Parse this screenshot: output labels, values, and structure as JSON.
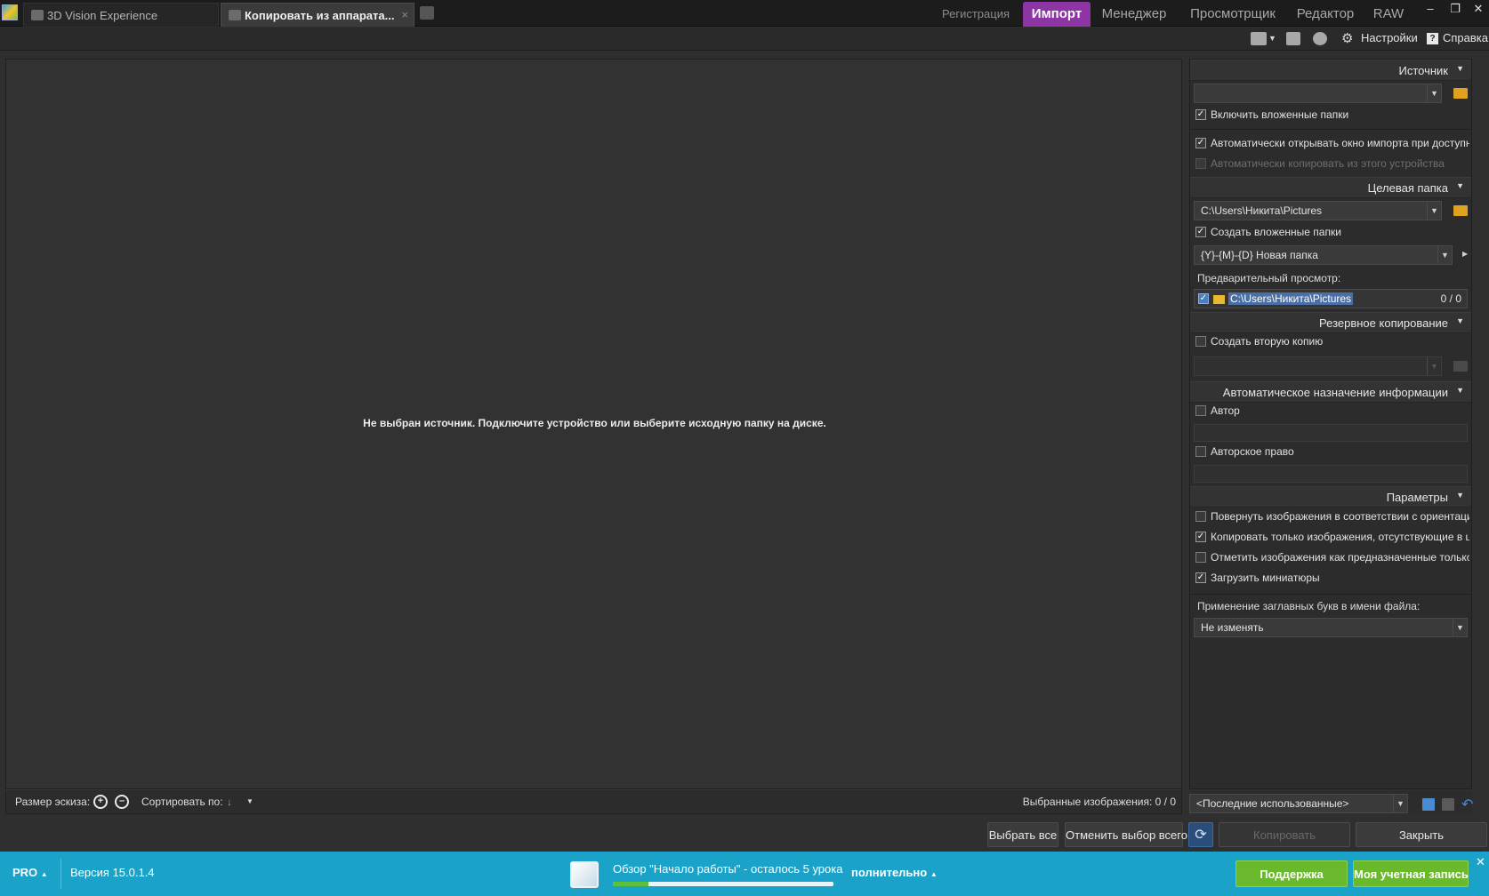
{
  "tabs": [
    {
      "label": "3D Vision Experience",
      "active": false
    },
    {
      "label": "Копировать из аппарата...",
      "active": true,
      "close": "×"
    }
  ],
  "modes": {
    "register": "Регистрация",
    "import": "Импорт",
    "manager": "Менеджер",
    "viewer": "Просмотрщик",
    "editor": "Редактор",
    "raw": "RAW"
  },
  "window_buttons": {
    "minimize": "–",
    "restore": "❐",
    "close": "✕"
  },
  "toolbar": {
    "settings": "Настройки",
    "help": "Справка",
    "help_glyph": "?",
    "settings_glyph": "⚙"
  },
  "viewer": {
    "empty_message": "Не выбран источник. Подключите устройство или выберите исходную папку на диске.",
    "thumb_size_label": "Размер эскиза:",
    "sort_label": "Сортировать по:",
    "sort_glyph": "↓",
    "selected_images": "Выбранные изображения: 0 / 0"
  },
  "panel": {
    "source": {
      "title": "Источник",
      "path": "",
      "include_subfolders": {
        "label": "Включить вложенные папки",
        "checked": true
      },
      "auto_open": {
        "label": "Автоматически открывать окно импорта при доступн",
        "checked": true
      },
      "auto_copy": {
        "label": "Автоматически копировать из этого устройства",
        "checked": false,
        "disabled": true
      }
    },
    "target": {
      "title": "Целевая папка",
      "path": "C:\\Users\\Никита\\Pictures",
      "create_subfolders": {
        "label": "Создать вложенные папки",
        "checked": true
      },
      "pattern": "{Y}-{M}-{D} Новая папка",
      "preview_label": "Предварительный просмотр:",
      "preview_path": "C:\\Users\\Никита\\Pictures",
      "preview_count": "0 / 0"
    },
    "backup": {
      "title": "Резервное копирование",
      "second_copy": {
        "label": "Создать вторую копию",
        "checked": false
      }
    },
    "auto_info": {
      "title": "Автоматическое назначение информации",
      "author": {
        "label": "Автор",
        "checked": false,
        "value": ""
      },
      "copyright": {
        "label": "Авторское право",
        "checked": false,
        "value": ""
      }
    },
    "params": {
      "title": "Параметры",
      "rotate": {
        "label": "Повернуть изображения в соответствии с ориентаци",
        "checked": false
      },
      "copy_missing": {
        "label": "Копировать только изображения, отсутствующие в ц",
        "checked": true
      },
      "mark": {
        "label": "Отметить изображения как предназначенные только",
        "checked": false
      },
      "thumbs": {
        "label": "Загрузить миниатюры",
        "checked": true
      },
      "caps_label": "Применение заглавных букв в имени файла:",
      "caps_value": "Не изменять"
    },
    "preset": "<Последние использованные>"
  },
  "buttons": {
    "select_all": "Выбрать все",
    "deselect_all": "Отменить выбор всего",
    "refresh_glyph": "⟳",
    "copy": "Копировать",
    "close": "Закрыть"
  },
  "status": {
    "edition": "PRO",
    "version": "Версия 15.0.1.4",
    "tutorial": "Обзор \"Начало работы\" - осталось 5 урока",
    "tutorial_progress": 0.16,
    "more": "полнительно",
    "support": "Поддержка",
    "account": "Моя учетная запись",
    "close": "✕"
  },
  "icons": {
    "check": "✓",
    "caret_down": "▼",
    "caret_up": "▲",
    "caret_right": "▶"
  },
  "colors": {
    "accent": "#8e35a5",
    "statusbar": "#1ba2c8",
    "green": "#6ab82c"
  }
}
